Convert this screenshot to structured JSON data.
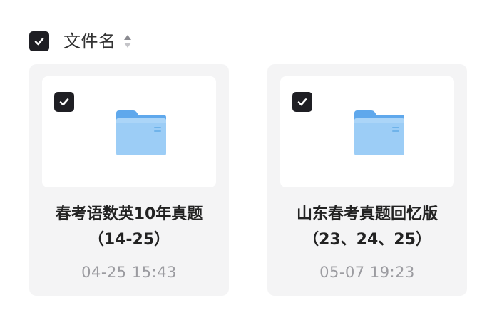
{
  "header": {
    "column_label": "文件名",
    "select_all_checked": true,
    "sort_icon": "sort-updown-icon"
  },
  "files": [
    {
      "name_line1": "春考语数英10年真题",
      "name_line2": "（14-25）",
      "modified": "04-25 15:43",
      "type_icon": "folder-icon",
      "checked": true
    },
    {
      "name_line1": "山东春考真题回忆版",
      "name_line2": "（23、24、25）",
      "modified": "05-07 19:23",
      "type_icon": "folder-icon",
      "checked": true
    }
  ],
  "colors": {
    "checkbox_fill": "#1f1f24",
    "card_bg": "#f4f4f5",
    "folder_front": "#8fc7f5",
    "folder_back": "#5fa8ec",
    "time_text": "#9b9ba0"
  }
}
